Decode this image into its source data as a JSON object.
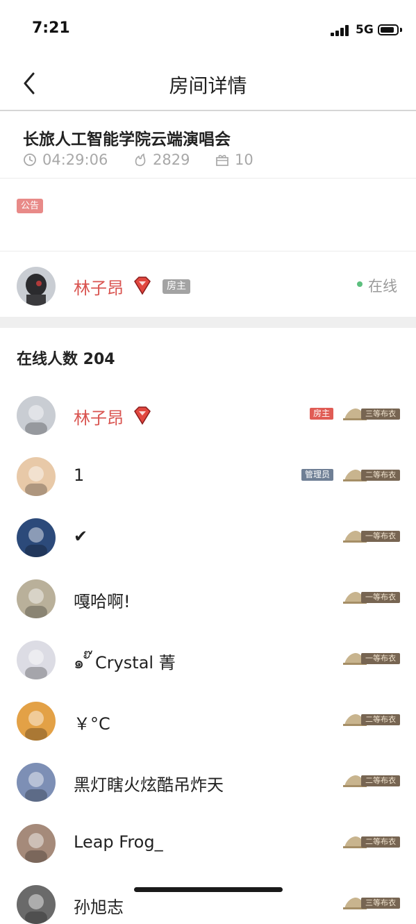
{
  "status_bar": {
    "time": "7:21",
    "network": "5G"
  },
  "nav": {
    "title": "房间详情"
  },
  "room": {
    "name": "长旅人工智能学院云端演唱会",
    "duration": "04:29:06",
    "likes": "2829",
    "gifts": "10"
  },
  "notice": {
    "tag": "公告"
  },
  "host": {
    "name": "林子昂",
    "tag": "房主",
    "status": "在线"
  },
  "online": {
    "label": "在线人数 204"
  },
  "members": [
    {
      "name": "林子昂",
      "role": "房主",
      "rank": "三等布衣",
      "highlight": true
    },
    {
      "name": "1",
      "role": "管理员",
      "rank": "二等布衣"
    },
    {
      "name": "✔",
      "role": "",
      "rank": "一等布衣"
    },
    {
      "name": "嘎哈啊!",
      "role": "",
      "rank": "一等布衣"
    },
    {
      "name": "๑ ั๊ Crystal 菁",
      "role": "",
      "rank": "一等布衣"
    },
    {
      "name": "￥°C",
      "role": "",
      "rank": "二等布衣"
    },
    {
      "name": "黑灯瞎火炫酷吊炸天",
      "role": "",
      "rank": "二等布衣"
    },
    {
      "name": "Leap Frog_",
      "role": "",
      "rank": "二等布衣"
    },
    {
      "name": "孙旭志",
      "role": "",
      "rank": "三等布衣"
    }
  ],
  "colors": {
    "accent_red": "#d9534f",
    "online_green": "#5cbf7e",
    "rank_plate": "#776552"
  }
}
